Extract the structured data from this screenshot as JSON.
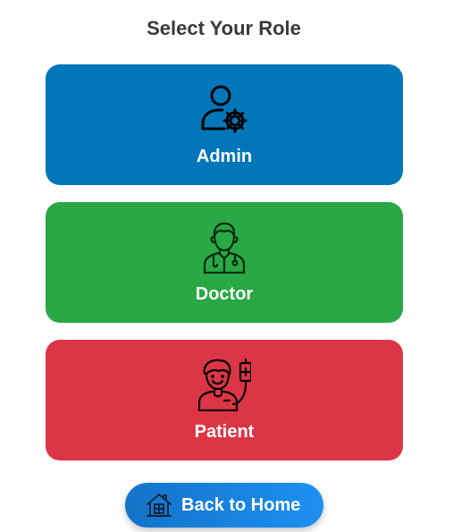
{
  "title": "Select Your Role",
  "roles": [
    {
      "id": "admin",
      "label": "Admin",
      "icon": "admin-gear-user-icon",
      "color": "#0177b9"
    },
    {
      "id": "doctor",
      "label": "Doctor",
      "icon": "doctor-icon",
      "color": "#29a845"
    },
    {
      "id": "patient",
      "label": "Patient",
      "icon": "patient-iv-drip-icon",
      "color": "#dc3545"
    }
  ],
  "back_button": {
    "label": "Back to Home",
    "icon": "home-icon",
    "gradient_start": "#1273c8",
    "gradient_end": "#1e90f2"
  }
}
